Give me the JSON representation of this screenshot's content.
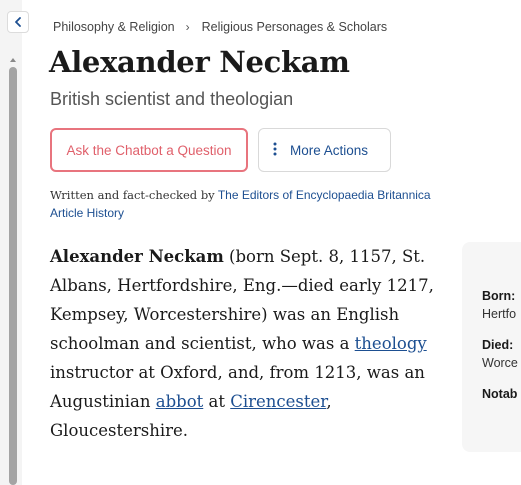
{
  "breadcrumb": {
    "items": [
      "Philosophy & Religion",
      "Religious Personages & Scholars"
    ],
    "separator": "›"
  },
  "article": {
    "title": "Alexander Neckam",
    "subtitle": "British scientist and theologian",
    "actions": {
      "chatbot_label": "Ask the Chatbot a Question",
      "more_label": "More Actions"
    },
    "byline": {
      "prefix": "Written and fact-checked by",
      "authors_link": "The Editors of Encyclopaedia Britannica",
      "history_link": "Article History"
    },
    "body": {
      "lead_name": "Alexander Neckam",
      "text_1": " (born Sept. 8, 1157, St. Albans, Hertfordshire, Eng.—died early 1217, Kempsey, Worcestershire) was an English schoolman and scientist, who was a ",
      "link_1": "theology",
      "text_2": " instructor at Oxford, and, from 1213, was an Augustinian ",
      "link_2": "abbot",
      "text_3": " at ",
      "link_3": "Cirencester",
      "text_4": ", Gloucestershire."
    }
  },
  "facts": {
    "born_label": "Born:",
    "born_value": "Hertfo",
    "died_label": "Died:",
    "died_value": "Worce",
    "notable_label": "Notab"
  },
  "colors": {
    "link": "#1d4f91",
    "chatbot_accent": "#e8747e",
    "facts_background": "#f6f6f6"
  },
  "icons": {
    "collapse": "chevron-left-icon",
    "more": "vertical-dots-icon"
  }
}
